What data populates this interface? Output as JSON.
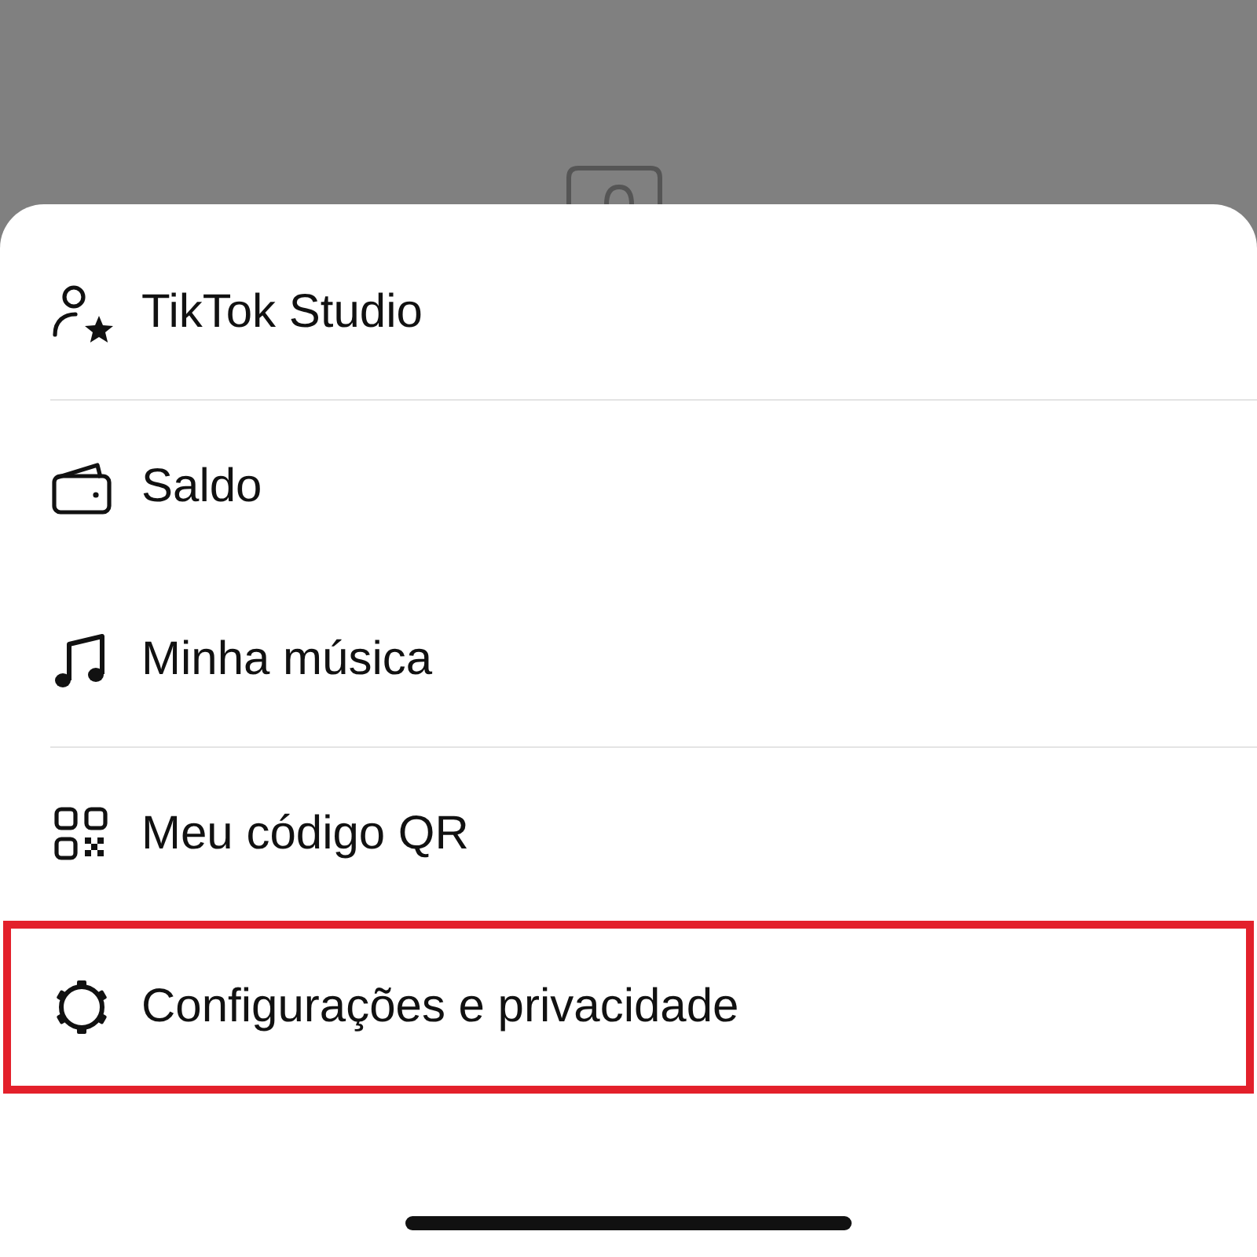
{
  "menu": {
    "items": [
      {
        "kind": "studio",
        "label": "TikTok Studio",
        "divider": true,
        "highlighted": false
      },
      {
        "kind": "wallet",
        "label": "Saldo",
        "divider": false,
        "highlighted": false
      },
      {
        "kind": "music",
        "label": "Minha música",
        "divider": true,
        "highlighted": false
      },
      {
        "kind": "qr",
        "label": "Meu código QR",
        "divider": false,
        "highlighted": false
      },
      {
        "kind": "settings",
        "label": "Configurações e privacidade",
        "divider": false,
        "highlighted": true
      }
    ]
  }
}
